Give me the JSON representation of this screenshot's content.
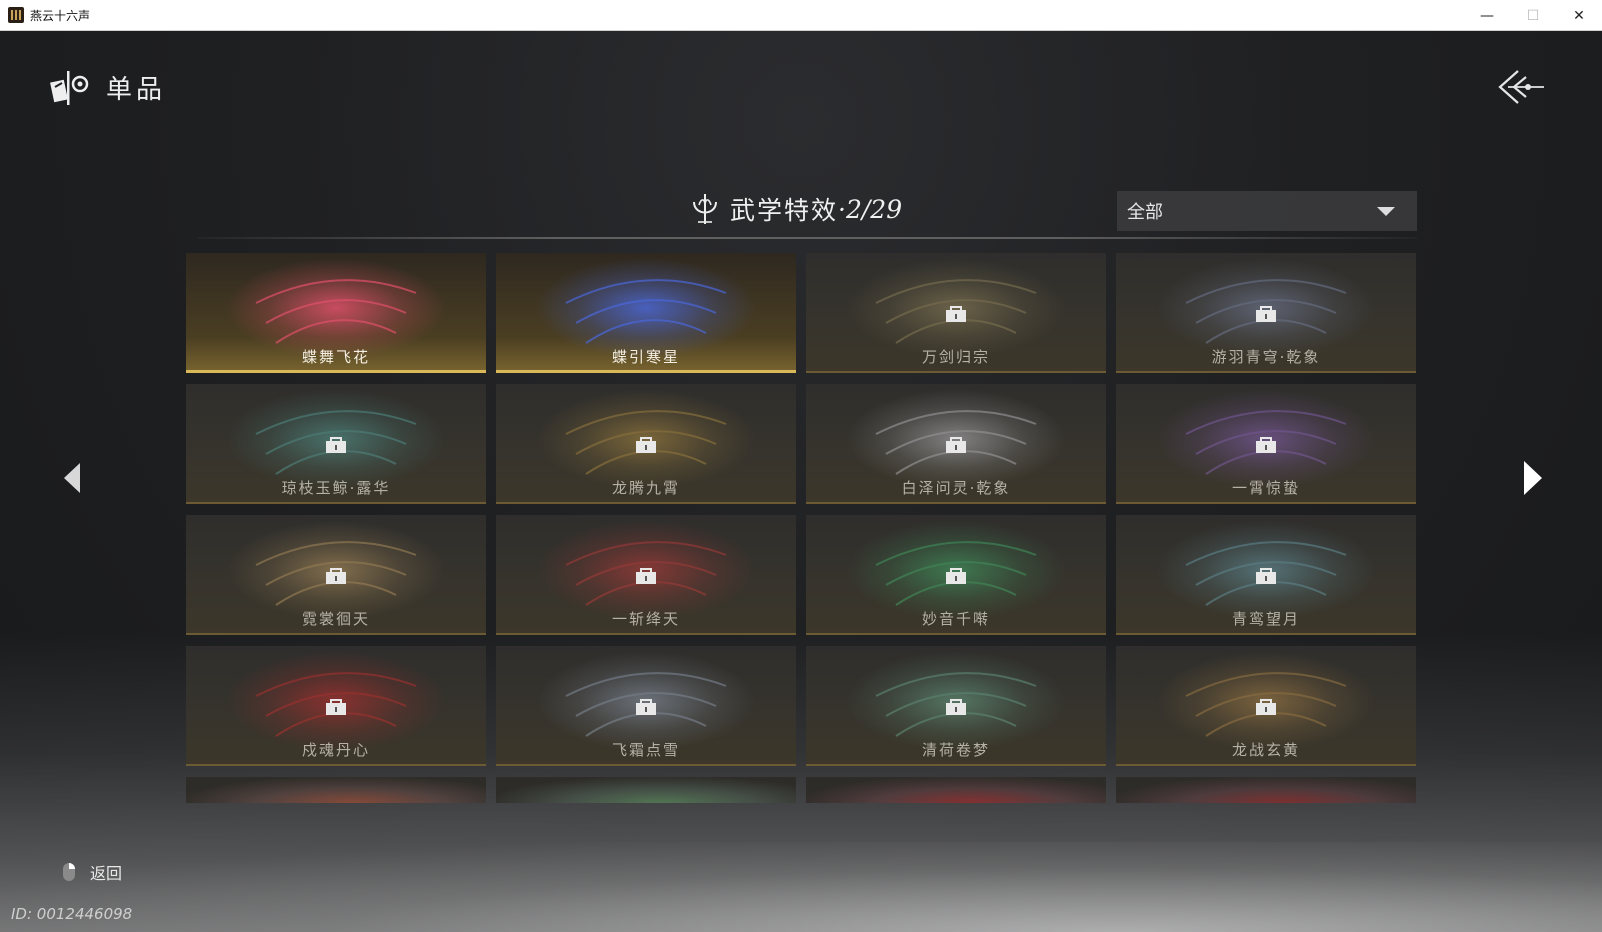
{
  "window": {
    "title": "燕云十六声",
    "minimize": "—",
    "maximize": "☐",
    "close": "✕"
  },
  "header": {
    "title": "单品",
    "icon": "item-emblem-icon",
    "back_icon": "back-arrow-icon"
  },
  "section": {
    "label": "武学特效",
    "count": "·2/29"
  },
  "filter": {
    "value": "全部"
  },
  "tiles": [
    {
      "name": "蝶舞飞花",
      "locked": false,
      "accent": "#e0506a"
    },
    {
      "name": "蝶引寒星",
      "locked": false,
      "accent": "#4a67d8"
    },
    {
      "name": "万剑归宗",
      "locked": true,
      "accent": "#a89868"
    },
    {
      "name": "游羽青穹·乾象",
      "locked": true,
      "accent": "#8a98c0"
    },
    {
      "name": "琼枝玉鲸·露华",
      "locked": true,
      "accent": "#5fb8b0"
    },
    {
      "name": "龙腾九霄",
      "locked": true,
      "accent": "#c8a048"
    },
    {
      "name": "白泽问灵·乾象",
      "locked": true,
      "accent": "#d8d8e0"
    },
    {
      "name": "一霄惊蛰",
      "locked": true,
      "accent": "#a070d8"
    },
    {
      "name": "霓裳徊天",
      "locked": true,
      "accent": "#d8b070"
    },
    {
      "name": "一斩绛天",
      "locked": true,
      "accent": "#e04040"
    },
    {
      "name": "妙音千啭",
      "locked": true,
      "accent": "#48c878"
    },
    {
      "name": "青鸾望月",
      "locked": true,
      "accent": "#78b8c8"
    },
    {
      "name": "戍魂丹心",
      "locked": true,
      "accent": "#e83030"
    },
    {
      "name": "飞霜点雪",
      "locked": true,
      "accent": "#a8b8d0"
    },
    {
      "name": "清荷卷梦",
      "locked": true,
      "accent": "#78c0a0"
    },
    {
      "name": "龙战玄黄",
      "locked": true,
      "accent": "#c89850"
    }
  ],
  "partial_row_accents": [
    "#c05030",
    "#60a060",
    "#c02020",
    "#b02020"
  ],
  "footer": {
    "exit_label": "返回",
    "mouse_icon": "mouse-right-click-icon",
    "player_id": "ID: 0012446098"
  },
  "nav": {
    "prev_icon": "arrow-left-icon",
    "next_icon": "arrow-right-icon"
  }
}
